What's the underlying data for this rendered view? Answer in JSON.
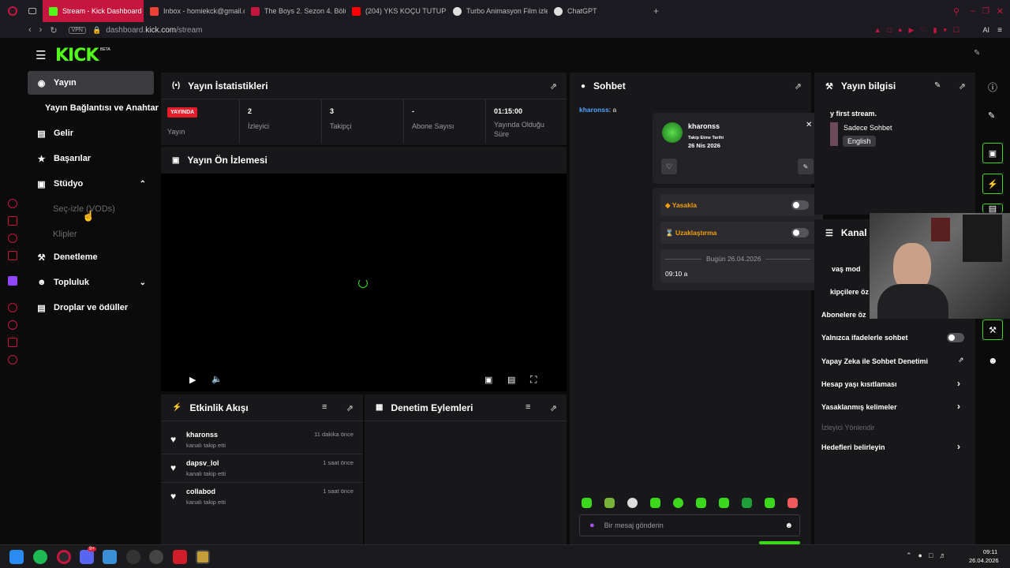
{
  "browser": {
    "tabs": [
      {
        "label": "Stream - Kick Dashboard",
        "color": "#53fc18",
        "active": true
      },
      {
        "label": "Inbox - homiekck@gmail.c",
        "color": "#ea4335",
        "active": false
      },
      {
        "label": "The Boys 2. Sezon 4. Bölü",
        "color": "#c5163f",
        "active": false
      },
      {
        "label": "(204) YKS KOÇU TUTUP",
        "color": "#ff0000",
        "active": false
      },
      {
        "label": "Turbo Animasyon Film izle",
        "color": "#dddddd",
        "active": false
      },
      {
        "label": "ChatGPT",
        "color": "#dddddd",
        "active": false
      }
    ],
    "vpn": "VPN",
    "url_gray": "dashboard.",
    "url_main": "kick.com",
    "url_path": "/stream",
    "ai_label": "AI"
  },
  "header": {
    "logo": "KICK",
    "beta": "BETA"
  },
  "sidebar": {
    "items": [
      {
        "label": "Yayın",
        "icon": "broadcast-icon"
      },
      {
        "label": "Yayın Bağlantısı ve Anahtarı",
        "icon": ""
      },
      {
        "label": "Gelir",
        "icon": "chart-icon"
      },
      {
        "label": "Başarılar",
        "icon": "trophy-icon"
      },
      {
        "label": "Stüdyo",
        "icon": "studio-icon"
      },
      {
        "label": "Seç-izle (VODs)",
        "icon": ""
      },
      {
        "label": "Klipler",
        "icon": ""
      },
      {
        "label": "Denetleme",
        "icon": "wrench-icon"
      },
      {
        "label": "Topluluk",
        "icon": "community-icon"
      },
      {
        "label": "Droplar ve ödüller",
        "icon": "drops-icon"
      }
    ]
  },
  "stats_panel": {
    "title": "Yayın İstatistikleri",
    "live_badge": "YAYINDA",
    "live_label": "Yayın",
    "viewers_value": "2",
    "viewers_label": "İzleyici",
    "followers_value": "3",
    "followers_label": "Takipçi",
    "subs_value": "-",
    "subs_label": "Abone Sayısı",
    "uptime_value": "01:15:00",
    "uptime_label": "Yayında Olduğu Süre"
  },
  "preview_panel": {
    "title": "Yayın Ön İzlemesi"
  },
  "activity_panel": {
    "title": "Etkinlik Akışı",
    "events": [
      {
        "name": "kharonss",
        "action": "kanalı takip etti",
        "time": "11 dakika önce"
      },
      {
        "name": "dapsv_lol",
        "action": "kanalı takip etti",
        "time": "1 saat önce"
      },
      {
        "name": "collabod",
        "action": "kanalı takip etti",
        "time": "1 saat önce"
      }
    ]
  },
  "moderation_panel": {
    "title": "Denetim Eylemleri"
  },
  "chat_panel": {
    "title": "Sohbet",
    "message_user": "kharonss",
    "message_text": ": a",
    "input_placeholder": "Bir mesaj gönderin"
  },
  "user_popup": {
    "username": "kharonss",
    "follow_label": "Takip Etme Tarihi",
    "follow_date": "26 Nis 2026",
    "ban_label": "Yasakla",
    "timeout_label": "Uzaklaştırma",
    "history_date": "Bugün 26.04.2026",
    "history_msg": "09:10 a"
  },
  "info_panel": {
    "title": "Yayın bilgisi",
    "stream_title": "y first stream.",
    "category": "Sadece Sohbet",
    "language": "English"
  },
  "channel_panel": {
    "title": "Kanal",
    "rows": [
      "vaş mod",
      "kipçilere öz",
      "Abonelere öz",
      "Yalnızca ifadelerle sohbet",
      "Yapay Zeka ile Sohbet Denetimi",
      "Hesap yaşı kısıtlaması",
      "Yasaklanmış kelimeler",
      "İzleyici Yönlendir",
      "Hedefleri belirleyin"
    ]
  },
  "taskbar": {
    "time": "09:11",
    "date": "26.04.2026",
    "discord_badge": "9+"
  },
  "colors": {
    "accent": "#53fc18",
    "live": "#e51d2a",
    "opera": "#c5163f"
  }
}
